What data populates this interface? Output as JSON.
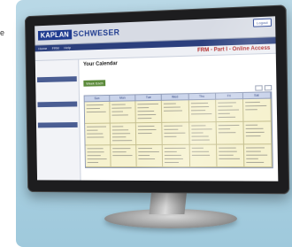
{
  "edge_marker": "e",
  "header": {
    "logo_part1": "KAPLAN",
    "logo_part2": "SCHWESER",
    "top_links": [
      "Logout"
    ]
  },
  "nav": {
    "tabs": [
      "Home",
      "FRM",
      "Help"
    ]
  },
  "course_title": "FRM - Part I - Online Access",
  "calendar": {
    "title": "Your Calendar",
    "week_label": "Week Each",
    "days": [
      "Sun",
      "Mon",
      "Tue",
      "Wed",
      "Thu",
      "Fri",
      "Sat"
    ]
  },
  "colors": {
    "brand": "#1f3b8f",
    "title_red": "#b02323",
    "cell_yellow": "#f6f2cf",
    "week_green": "#5b8a3a"
  }
}
